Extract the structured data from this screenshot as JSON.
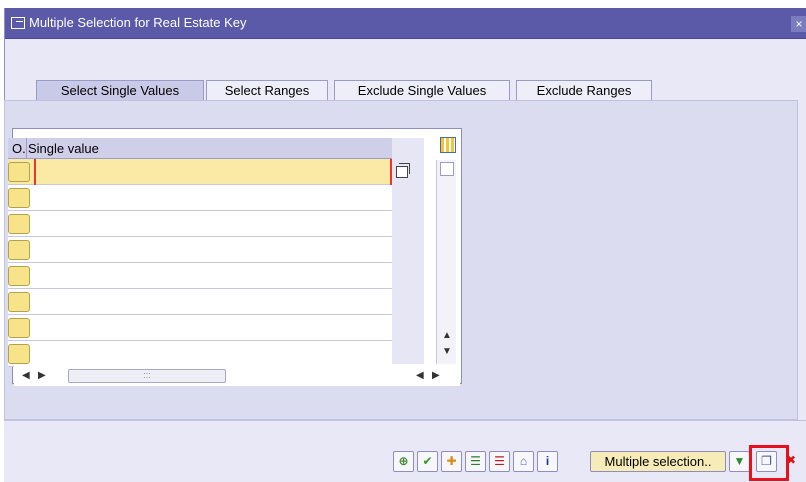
{
  "dialog": {
    "title": "Multiple Selection for Real Estate Key",
    "close_symbol": "×"
  },
  "tabs": [
    {
      "label": "Select Single Values",
      "active": true
    },
    {
      "label": "Select Ranges",
      "active": false
    },
    {
      "label": "Exclude Single Values",
      "active": false
    },
    {
      "label": "Exclude Ranges",
      "active": false
    }
  ],
  "table": {
    "headers": {
      "option": "O.",
      "value": "Single value"
    },
    "rows": [
      "",
      "",
      "",
      "",
      "",
      "",
      "",
      ""
    ],
    "hscroll_thumb_label": ":::"
  },
  "toolbar": {
    "multiple_selection_label": "Multiple selection..",
    "icons": [
      "check-entries-icon",
      "copy-checkmark-icon",
      "insert-line-icon",
      "insert-row-icon",
      "delete-row-icon",
      "delete-all-icon",
      "info-icon",
      "import-icon",
      "paste-from-clipboard-icon",
      "cancel-icon"
    ]
  },
  "colors": {
    "title_bar": "#5b5aa8",
    "dialog_bg": "#e8e8f6",
    "selected_row": "#fbe9a6",
    "highlight": "#e8101c"
  }
}
